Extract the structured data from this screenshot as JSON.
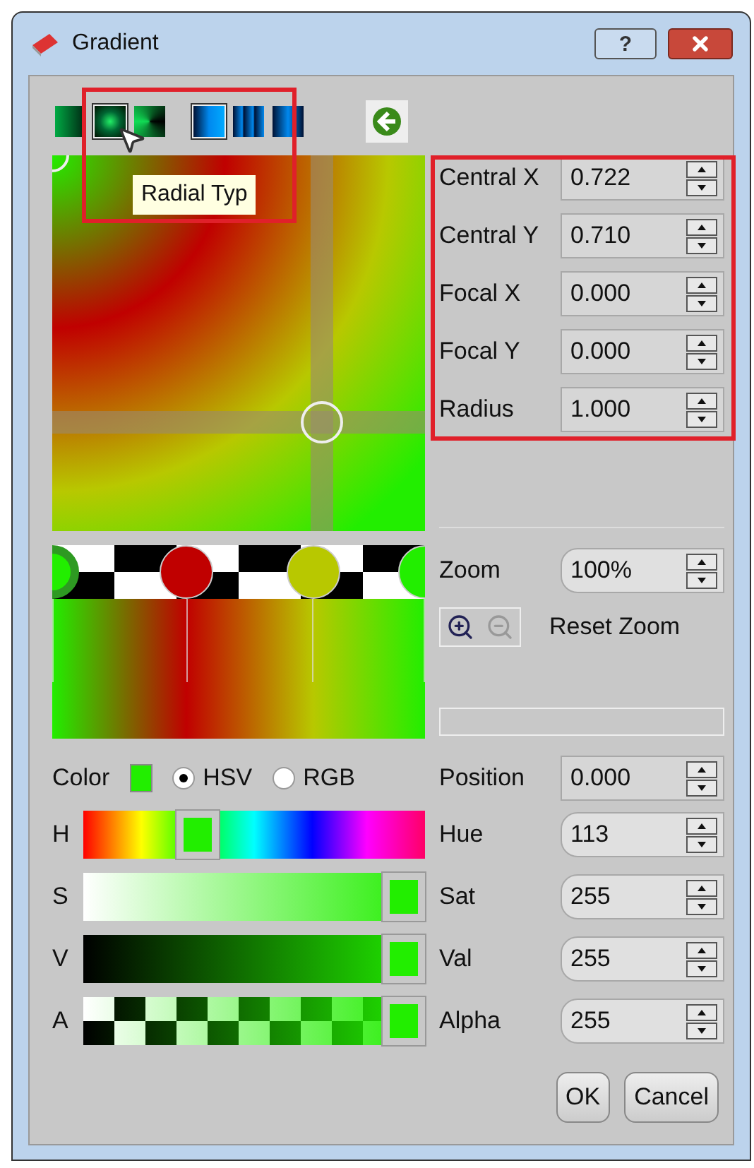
{
  "window": {
    "title": "Gradient",
    "help_button": "?"
  },
  "gradient_types": [
    {
      "kind": "linear",
      "selected": false
    },
    {
      "kind": "radial",
      "selected": true
    },
    {
      "kind": "conical",
      "selected": false
    }
  ],
  "spread_modes": [
    {
      "kind": "pad",
      "selected": true
    },
    {
      "kind": "repeat",
      "selected": false
    },
    {
      "kind": "reflect",
      "selected": false
    }
  ],
  "tooltip": "Radial Typ",
  "geometry": [
    {
      "label": "Central X",
      "value": "0.722"
    },
    {
      "label": "Central Y",
      "value": "0.710"
    },
    {
      "label": "Focal X",
      "value": "0.000"
    },
    {
      "label": "Focal Y",
      "value": "0.000"
    },
    {
      "label": "Radius",
      "value": "1.000"
    }
  ],
  "stops": [
    {
      "color": "#22ee00",
      "level": 0,
      "selected": true
    },
    {
      "color": "#c00000",
      "level": 0.36,
      "selected": false
    },
    {
      "color": "#b8c800",
      "level": 0.7,
      "selected": false
    },
    {
      "color": "#22ee00",
      "level": 1,
      "selected": false
    }
  ],
  "zoom": {
    "label": "Zoom",
    "value": "100%",
    "reset_label": "Reset Zoom"
  },
  "color": {
    "label": "Color",
    "color": "#22ee00",
    "modes": [
      {
        "label": "HSV",
        "selected": true
      },
      {
        "label": "RGB",
        "selected": false
      }
    ]
  },
  "position": {
    "label": "Position",
    "value": "0.000"
  },
  "channels": [
    {
      "kind": "hue",
      "letter": "H",
      "label": "Hue",
      "value": "113",
      "level": 0.31
    },
    {
      "kind": "saturation",
      "letter": "S",
      "label": "Sat",
      "value": "255",
      "level": 1
    },
    {
      "kind": "value",
      "letter": "V",
      "label": "Val",
      "value": "255",
      "level": 1
    },
    {
      "kind": "alpha",
      "letter": "A",
      "label": "Alpha",
      "value": "255",
      "level": 1
    }
  ],
  "buttons": [
    {
      "label": "OK"
    },
    {
      "label": "Cancel"
    }
  ]
}
